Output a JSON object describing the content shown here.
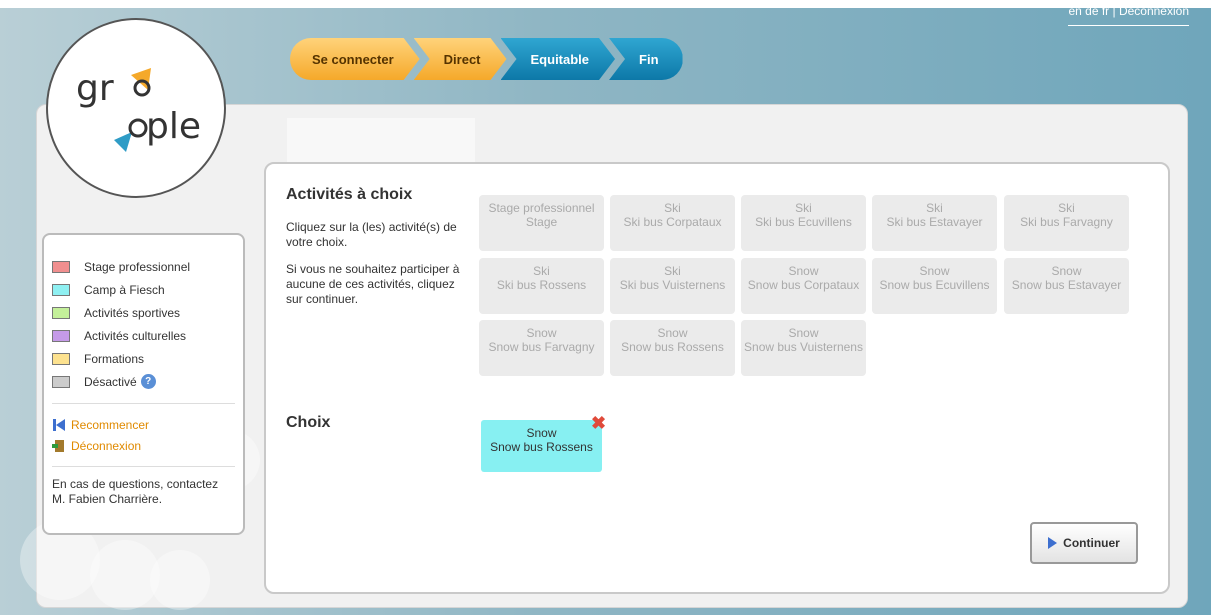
{
  "header": {
    "top_links": "en de fr | Déconnexion",
    "steps": [
      "Se connecter",
      "Direct",
      "Equitable",
      "Fin"
    ]
  },
  "logo": {
    "text": "grouple"
  },
  "legend": {
    "items": [
      {
        "label": "Stage professionnel",
        "color": "#f08f8f"
      },
      {
        "label": "Camp à Fiesch",
        "color": "#8ff0f2"
      },
      {
        "label": "Activités sportives",
        "color": "#c4f09a"
      },
      {
        "label": "Activités culturelles",
        "color": "#c59ae8"
      },
      {
        "label": "Formations",
        "color": "#fde28f"
      },
      {
        "label": "Désactivé",
        "color": "#cccccc"
      }
    ],
    "links": [
      "Recommencer",
      "Déconnexion"
    ],
    "contact_line1": "En cas de questions, contactez",
    "contact_line2": "M. Fabien Charrière."
  },
  "main": {
    "activities_title": "Activités à choix",
    "instruction1": "Cliquez sur la (les) activité(s) de votre choix.",
    "instruction2": "Si vous ne souhaitez participer à aucune de ces activités, cliquez sur continuer.",
    "activities": [
      {
        "cat": "Stage professionnel",
        "name": "Stage"
      },
      {
        "cat": "Ski",
        "name": "Ski bus Corpataux"
      },
      {
        "cat": "Ski",
        "name": "Ski bus Ecuvillens"
      },
      {
        "cat": "Ski",
        "name": "Ski bus Estavayer"
      },
      {
        "cat": "Ski",
        "name": "Ski bus Farvagny"
      },
      {
        "cat": "Ski",
        "name": "Ski bus Rossens"
      },
      {
        "cat": "Ski",
        "name": "Ski bus Vuisternens"
      },
      {
        "cat": "Snow",
        "name": "Snow bus Corpataux"
      },
      {
        "cat": "Snow",
        "name": "Snow bus Ecuvillens"
      },
      {
        "cat": "Snow",
        "name": "Snow bus Estavayer"
      },
      {
        "cat": "Snow",
        "name": "Snow bus Farvagny"
      },
      {
        "cat": "Snow",
        "name": "Snow bus Rossens"
      },
      {
        "cat": "Snow",
        "name": "Snow bus Vuisternens"
      }
    ],
    "choice_title": "Choix",
    "choice": {
      "cat": "Snow",
      "name": "Snow bus Rossens"
    },
    "continue_label": "Continuer"
  }
}
